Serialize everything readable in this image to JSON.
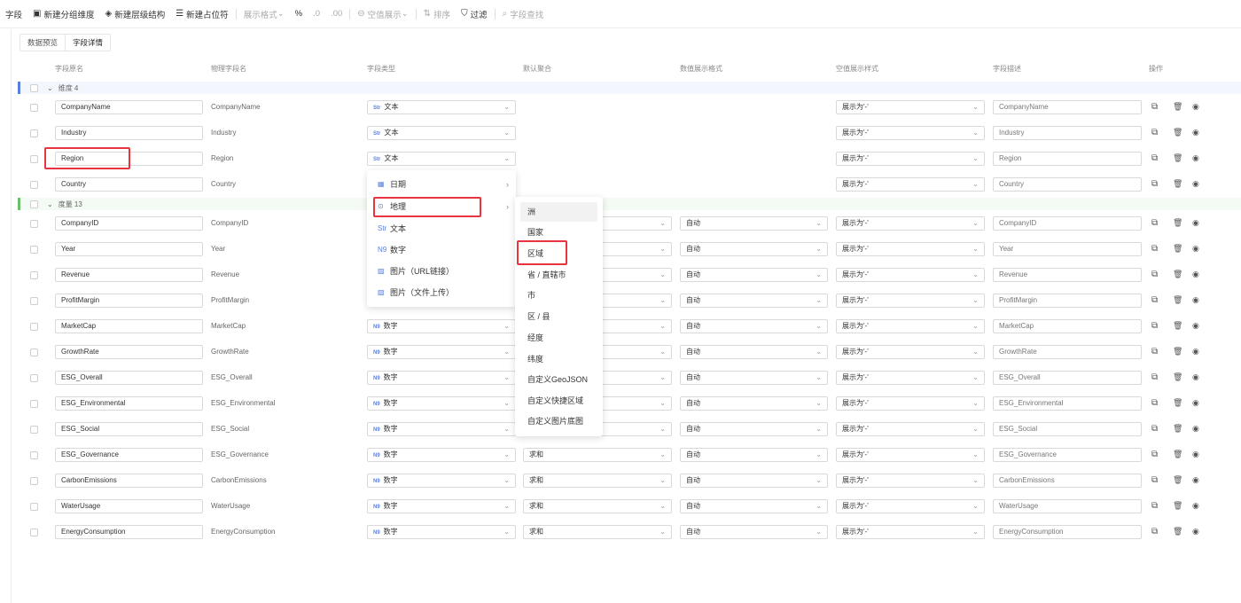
{
  "toolbar": {
    "items": [
      {
        "label": "字段",
        "icon": "",
        "disabled": false
      },
      {
        "label": "新建分组维度",
        "icon": "▣",
        "disabled": false
      },
      {
        "label": "新建层级结构",
        "icon": "◈",
        "disabled": false
      },
      {
        "label": "新建占位符",
        "icon": "☰",
        "disabled": false
      },
      {
        "label": "展示格式",
        "icon": "",
        "disabled": true,
        "suffix": "⌄"
      },
      {
        "label": "%",
        "icon": "",
        "disabled": false
      },
      {
        "label": ".0",
        "icon": "",
        "disabled": true
      },
      {
        "label": ".00",
        "icon": "",
        "disabled": true
      },
      {
        "label": "空值展示",
        "icon": "⊖",
        "disabled": true,
        "suffix": "⌄"
      },
      {
        "label": "排序",
        "icon": "⇅",
        "disabled": true
      },
      {
        "label": "过滤",
        "icon": "⛉",
        "disabled": false
      },
      {
        "label": "字段查找",
        "icon": "⌕",
        "disabled": true
      }
    ]
  },
  "tabs": [
    "数据预览",
    "字段详情"
  ],
  "headers": [
    "字段原名",
    "物理字段名",
    "字段类型",
    "默认聚合",
    "数值展示格式",
    "空值展示样式",
    "字段描述",
    "操作"
  ],
  "groups": {
    "dimension": "维度 4",
    "measure": "度量 13"
  },
  "type_icons": {
    "text": "Str",
    "number": "N9"
  },
  "rows": [
    {
      "name": "CompanyName",
      "phys": "CompanyName",
      "type": "文本",
      "type_icon": "Str",
      "agg": "",
      "fmt": "",
      "null": "展示为'-'",
      "desc": "CompanyName"
    },
    {
      "name": "Industry",
      "phys": "Industry",
      "type": "文本",
      "type_icon": "Str",
      "agg": "",
      "fmt": "",
      "null": "展示为'-'",
      "desc": "Industry"
    },
    {
      "name": "Region",
      "phys": "Region",
      "type": "文本",
      "type_icon": "Str",
      "agg": "",
      "fmt": "",
      "null": "展示为'-'",
      "desc": "Region"
    },
    {
      "name": "Country",
      "phys": "Country",
      "type": "",
      "type_icon": "",
      "agg": "",
      "fmt": "",
      "null": "展示为'-'",
      "desc": "Country"
    },
    {
      "name": "CompanyID",
      "phys": "CompanyID",
      "type": "",
      "type_icon": "",
      "agg": "",
      "fmt": "自动",
      "null": "展示为'-'",
      "desc": "CompanyID"
    },
    {
      "name": "Year",
      "phys": "Year",
      "type": "",
      "type_icon": "",
      "agg": "",
      "fmt": "自动",
      "null": "展示为'-'",
      "desc": "Year"
    },
    {
      "name": "Revenue",
      "phys": "Revenue",
      "type": "",
      "type_icon": "",
      "agg": "",
      "fmt": "自动",
      "null": "展示为'-'",
      "desc": "Revenue"
    },
    {
      "name": "ProfitMargin",
      "phys": "ProfitMargin",
      "type": "",
      "type_icon": "",
      "agg": "",
      "fmt": "自动",
      "null": "展示为'-'",
      "desc": "ProfitMargin"
    },
    {
      "name": "MarketCap",
      "phys": "MarketCap",
      "type": "数字",
      "type_icon": "N9",
      "agg": "",
      "fmt": "自动",
      "null": "展示为'-'",
      "desc": "MarketCap"
    },
    {
      "name": "GrowthRate",
      "phys": "GrowthRate",
      "type": "数字",
      "type_icon": "N9",
      "agg": "",
      "fmt": "自动",
      "null": "展示为'-'",
      "desc": "GrowthRate"
    },
    {
      "name": "ESG_Overall",
      "phys": "ESG_Overall",
      "type": "数字",
      "type_icon": "N9",
      "agg": "",
      "fmt": "自动",
      "null": "展示为'-'",
      "desc": "ESG_Overall"
    },
    {
      "name": "ESG_Environmental",
      "phys": "ESG_Environmental",
      "type": "数字",
      "type_icon": "N9",
      "agg": "",
      "fmt": "自动",
      "null": "展示为'-'",
      "desc": "ESG_Environmental"
    },
    {
      "name": "ESG_Social",
      "phys": "ESG_Social",
      "type": "数字",
      "type_icon": "N9",
      "agg": "",
      "fmt": "自动",
      "null": "展示为'-'",
      "desc": "ESG_Social"
    },
    {
      "name": "ESG_Governance",
      "phys": "ESG_Governance",
      "type": "数字",
      "type_icon": "N9",
      "agg": "求和",
      "fmt": "自动",
      "null": "展示为'-'",
      "desc": "ESG_Governance"
    },
    {
      "name": "CarbonEmissions",
      "phys": "CarbonEmissions",
      "type": "数字",
      "type_icon": "N9",
      "agg": "求和",
      "fmt": "自动",
      "null": "展示为'-'",
      "desc": "CarbonEmissions"
    },
    {
      "name": "WaterUsage",
      "phys": "WaterUsage",
      "type": "数字",
      "type_icon": "N9",
      "agg": "求和",
      "fmt": "自动",
      "null": "展示为'-'",
      "desc": "WaterUsage"
    },
    {
      "name": "EnergyConsumption",
      "phys": "EnergyConsumption",
      "type": "数字",
      "type_icon": "N9",
      "agg": "求和",
      "fmt": "自动",
      "null": "展示为'-'",
      "desc": "EnergyConsumption"
    }
  ],
  "type_menu": [
    {
      "label": "日期",
      "icon": "calendar-icon",
      "glyph": "▦",
      "submenu": true
    },
    {
      "label": "地理",
      "icon": "location-pin-icon",
      "glyph": "⊙",
      "submenu": true
    },
    {
      "label": "文本",
      "icon": "text-type-icon",
      "glyph": "Str",
      "submenu": false
    },
    {
      "label": "数字",
      "icon": "number-type-icon",
      "glyph": "N9",
      "submenu": false
    },
    {
      "label": "图片（URL链接）",
      "icon": "image-icon",
      "glyph": "▨",
      "submenu": false
    },
    {
      "label": "图片（文件上传）",
      "icon": "image-upload-icon",
      "glyph": "▧",
      "submenu": false
    }
  ],
  "geo_submenu": [
    "洲",
    "国家",
    "区域",
    "省 / 直辖市",
    "市",
    "区 / 县",
    "经度",
    "纬度",
    "自定义GeoJSON",
    "自定义快捷区域",
    "自定义图片底图"
  ],
  "colors": {
    "accent": "#5b7fde",
    "highlight": "#e8343e",
    "dimension_bar": "#5b7fde",
    "measure_bar": "#6cc06c"
  }
}
